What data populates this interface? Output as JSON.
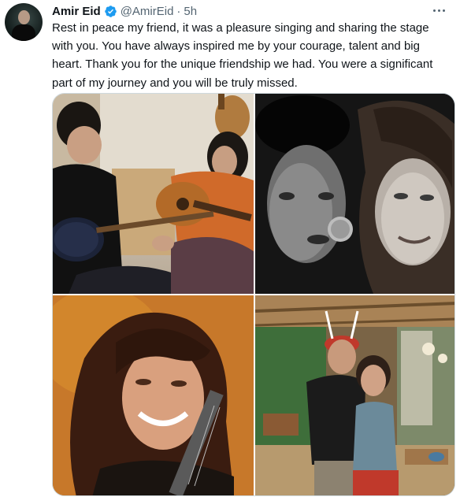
{
  "tweet": {
    "author_name": "Amir Eid",
    "handle": "@AmirEid",
    "separator": "·",
    "time": "5h",
    "text": "Rest in peace my friend, it was a pleasure singing and sharing the stage with you. You have always inspired me by your courage, talent and big heart. Thank you for the unique friendship we had. You were a significant part of my journey and you will be truly missed."
  },
  "icons": {
    "verified": "verified-badge-icon",
    "more": "more-options-icon"
  },
  "colors": {
    "verified_blue": "#1d9bf0",
    "secondary_text": "#536471",
    "primary_text": "#0f1419",
    "border": "#cfd9de"
  }
}
